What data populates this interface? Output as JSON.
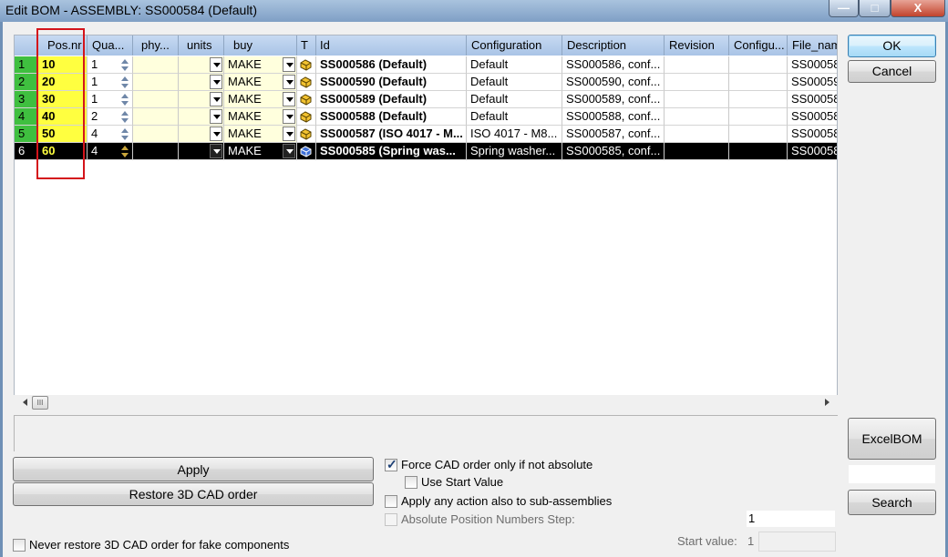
{
  "window": {
    "title": "Edit BOM - ASSEMBLY: SS000584 (Default)",
    "minimize_glyph": "—",
    "maximize_glyph": "□",
    "close_glyph": "X"
  },
  "columns": [
    "",
    "Pos.nr",
    "Qua...",
    "phy...",
    "units",
    "buy",
    "T",
    "Id",
    "Configuration",
    "Description",
    "Revision",
    "Configu...",
    "File_nam"
  ],
  "rows": [
    {
      "num": "1",
      "pos": "10",
      "qty": "1",
      "buy": "MAKE",
      "id": "SS000586 (Default)",
      "config": "Default",
      "desc": "SS000586, conf...",
      "file": "SS00058"
    },
    {
      "num": "2",
      "pos": "20",
      "qty": "1",
      "buy": "MAKE",
      "id": "SS000590 (Default)",
      "config": "Default",
      "desc": "SS000590, conf...",
      "file": "SS00059"
    },
    {
      "num": "3",
      "pos": "30",
      "qty": "1",
      "buy": "MAKE",
      "id": "SS000589 (Default)",
      "config": "Default",
      "desc": "SS000589, conf...",
      "file": "SS00058"
    },
    {
      "num": "4",
      "pos": "40",
      "qty": "2",
      "buy": "MAKE",
      "id": "SS000588 (Default)",
      "config": "Default",
      "desc": "SS000588, conf...",
      "file": "SS00058"
    },
    {
      "num": "5",
      "pos": "50",
      "qty": "4",
      "buy": "MAKE",
      "id": "SS000587 (ISO 4017 - M...",
      "config": "ISO 4017 - M8...",
      "desc": "SS000587, conf...",
      "file": "SS00058"
    },
    {
      "num": "6",
      "pos": "60",
      "qty": "4",
      "buy": "MAKE",
      "id": "SS000585 (Spring was...",
      "config": "Spring washer...",
      "desc": "SS000585, conf...",
      "file": "SS00058"
    }
  ],
  "selected_row": 6,
  "scrollbar": {
    "thumb_glyph": "III"
  },
  "buttons": {
    "ok": "OK",
    "cancel": "Cancel",
    "excel_bom": "ExcelBOM",
    "search": "Search",
    "apply": "Apply",
    "restore": "Restore 3D CAD order"
  },
  "options": {
    "force_cad": {
      "label": "Force CAD order only if not absolute",
      "checked": true
    },
    "use_start": {
      "label": "Use Start Value",
      "checked": false
    },
    "apply_sub": {
      "label": "Apply any action also to sub-assemblies",
      "checked": false
    },
    "abs_step": {
      "label": "Absolute Position Numbers Step:",
      "checked": false,
      "value": "1"
    },
    "never_restore": {
      "label": "Never restore 3D CAD order for fake components",
      "checked": false
    },
    "start_value": {
      "label": "Start value:",
      "value": "1"
    }
  },
  "colors": {
    "row_number": "#3fbf3f",
    "selected_row_number": "#c23ec2",
    "pos_highlight": "#ffff40",
    "annotation_box": "#d4141b"
  }
}
